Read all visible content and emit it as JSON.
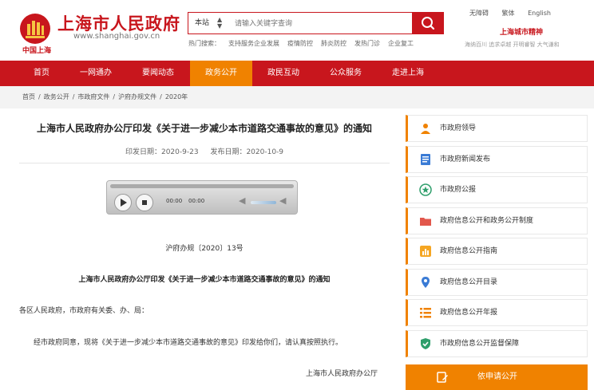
{
  "header": {
    "site_name": "上海市人民政府",
    "site_url": "www.shanghai.gov.cn",
    "logo_sub": "中国上海",
    "search": {
      "scope": "本站",
      "placeholder": "请输入关键字查询"
    },
    "hot_label": "热门搜索：",
    "hot_words": [
      "支持服务企业发展",
      "疫情防控",
      "肺炎防控",
      "发热门诊",
      "企业复工"
    ],
    "top_links": [
      "无障碍",
      "繁体",
      "English"
    ],
    "spirit_title": "上海城市精神",
    "spirit_text": "海纳百川 追求卓越 开明睿智 大气谦和"
  },
  "nav": [
    "首页",
    "一网通办",
    "要闻动态",
    "政务公开",
    "政民互动",
    "公众服务",
    "走进上海"
  ],
  "nav_active": "政务公开",
  "breadcrumb": [
    "首页",
    "/",
    "政务公开",
    "/",
    "市政府文件",
    "/",
    "沪府办规文件",
    "/",
    "2020年"
  ],
  "article": {
    "title": "上海市人民政府办公厅印发《关于进一步减少本市道路交通事故的意见》的通知",
    "issue_date": "印发日期：2020-9-23",
    "publish_date": "发布日期：2020-10-9",
    "player": {
      "time_current": "00:00",
      "time_total": "00:00"
    },
    "doc_no": "沪府办规〔2020〕13号",
    "doc_title": "上海市人民政府办公厅印发《关于进一步减少本市道路交通事故的意见》的通知",
    "para1": "各区人民政府，市政府有关委、办、局：",
    "para2": "经市政府同意，现将《关于进一步减少本市道路交通事故的意见》印发给你们，请认真按照执行。",
    "sign": "上海市人民政府办公厅"
  },
  "sidebar": {
    "items": [
      {
        "label": "市政府领导",
        "icon": "person-icon"
      },
      {
        "label": "市政府新闻发布",
        "icon": "document-icon"
      },
      {
        "label": "市政府公报",
        "icon": "star-icon"
      },
      {
        "label": "政府信息公开和政务公开制度",
        "icon": "folder-icon"
      },
      {
        "label": "政府信息公开指南",
        "icon": "chart-icon"
      },
      {
        "label": "政府信息公开目录",
        "icon": "location-icon"
      },
      {
        "label": "政府信息公开年报",
        "icon": "list-icon"
      },
      {
        "label": "市政府信息公开监督保障",
        "icon": "shield-icon"
      }
    ],
    "apply_label": "依申请公开"
  },
  "colors": {
    "brand_red": "#c8161d",
    "accent_orange": "#f08200"
  }
}
